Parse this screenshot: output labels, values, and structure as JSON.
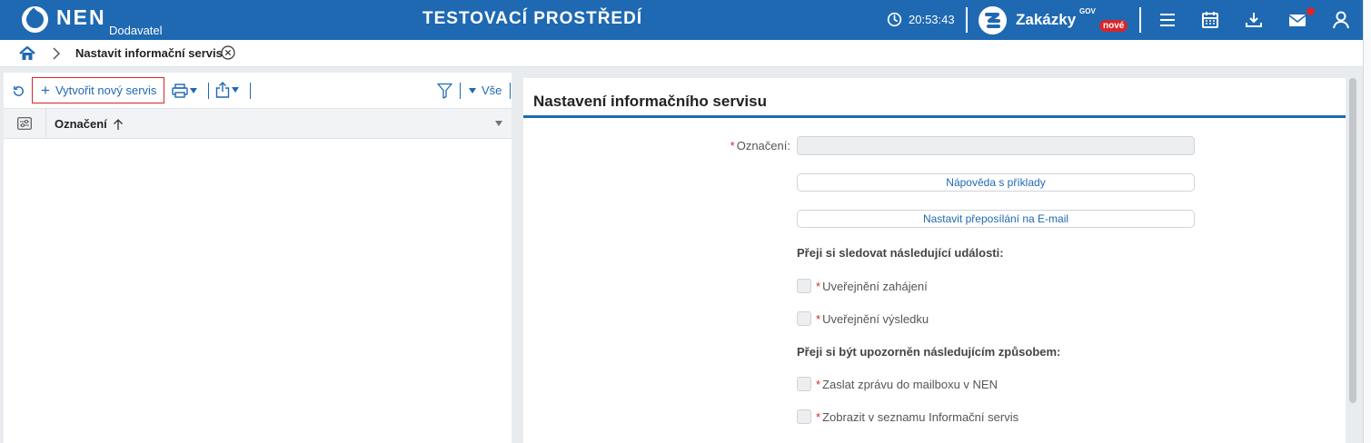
{
  "header": {
    "logo_text": "NEN",
    "logo_subtitle": "Dodavatel",
    "environment_title": "TESTOVACÍ PROSTŘEDÍ",
    "clock_time": "20:53:43",
    "zakazky_label": "Zakázky",
    "zakazky_gov": "GOV",
    "zakazky_badge": "nové",
    "icons": [
      "menu-icon",
      "calendar-icon",
      "download-icon",
      "mail-icon",
      "user-icon"
    ],
    "colors": {
      "bar": "#1f69b2",
      "badge": "#d8262b"
    }
  },
  "breadcrumb": {
    "current": "Nastavit informační servis"
  },
  "left_panel": {
    "create_button": "Vytvořit nový servis",
    "filter_label": "Vše",
    "column_header": "Označení"
  },
  "form": {
    "title": "Nastavení informačního servisu",
    "oznaceni_label": "Označení",
    "oznaceni_value": "",
    "help_button": "Nápověda s příklady",
    "email_button": "Nastavit přeposílání na E-mail",
    "events_heading": "Přeji si sledovat následující události:",
    "events": [
      {
        "label": "Uveřejnění zahájení",
        "checked": false
      },
      {
        "label": "Uveřejnění výsledku",
        "checked": false
      }
    ],
    "methods_heading": "Přeji si být upozorněn následujícím způsobem:",
    "methods": [
      {
        "label": "Zaslat zprávu do mailboxu v NEN",
        "checked": false
      },
      {
        "label": "Zobrazit v seznamu Informační servis",
        "checked": false
      }
    ]
  }
}
